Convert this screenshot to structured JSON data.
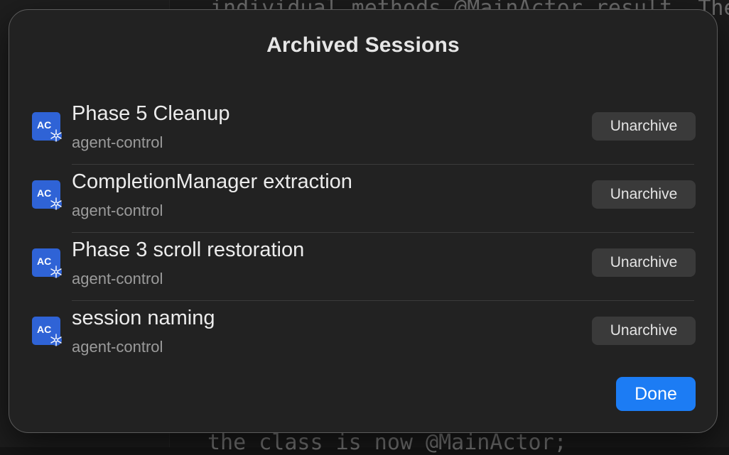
{
  "dialog": {
    "title": "Archived Sessions",
    "done_label": "Done"
  },
  "sessions": [
    {
      "title": "Phase 5 Cleanup",
      "project": "agent-control",
      "action": "Unarchive",
      "icon_text": "AC"
    },
    {
      "title": "CompletionManager extraction",
      "project": "agent-control",
      "action": "Unarchive",
      "icon_text": "AC"
    },
    {
      "title": "Phase 3 scroll restoration",
      "project": "agent-control",
      "action": "Unarchive",
      "icon_text": "AC"
    },
    {
      "title": "session naming",
      "project": "agent-control",
      "action": "Unarchive",
      "icon_text": "AC"
    }
  ],
  "background": {
    "top_text": "individual methods @MainActor result. The",
    "bottom_text": "the class is now @MainActor;"
  },
  "colors": {
    "dialog_bg": "#222222",
    "accent": "#1c7cf4",
    "app_icon": "#2f63d6",
    "button_bg": "#3a3a3a"
  }
}
